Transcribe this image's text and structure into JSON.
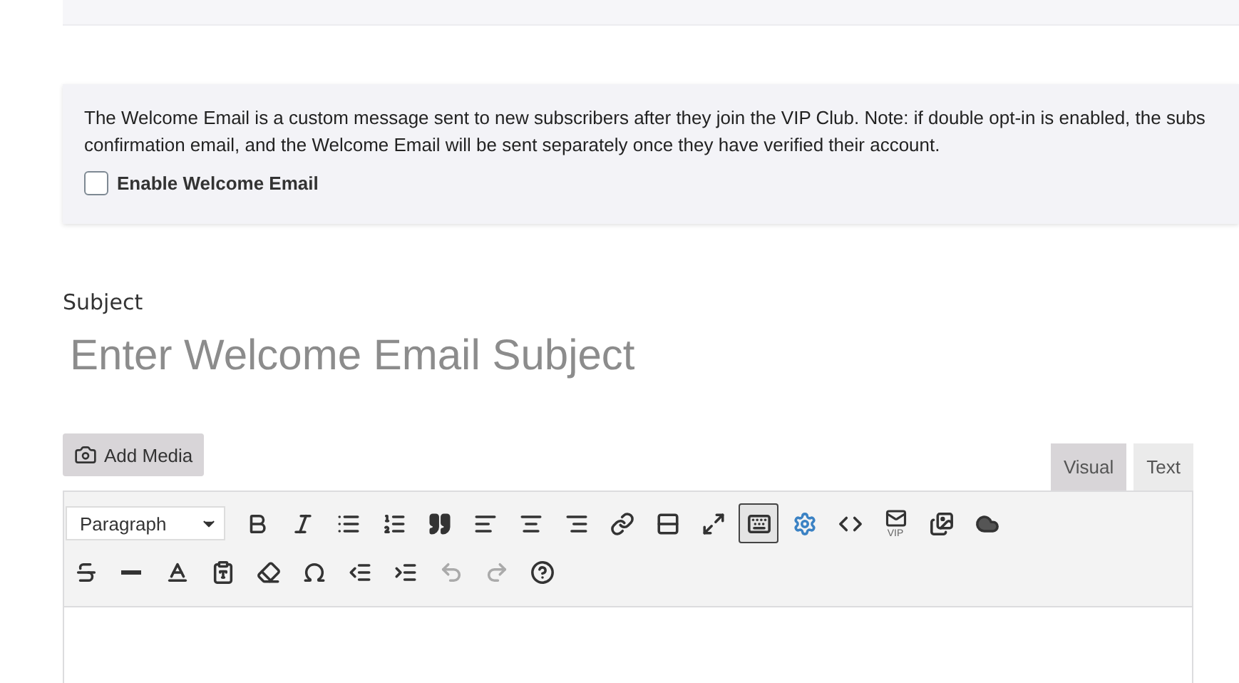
{
  "notice": {
    "lines": [
      "The Welcome Email is a custom message sent to new subscribers after they join the VIP Club. Note: if double opt-in is enabled, the subs",
      "confirmation email, and the Welcome Email will be sent separately once they have verified their account."
    ],
    "checkbox": {
      "label": "Enable Welcome Email",
      "checked": false
    }
  },
  "subject": {
    "label": "Subject",
    "placeholder": "Enter Welcome Email Subject"
  },
  "add_media": "Add Media",
  "tabs": [
    {
      "label": "Visual",
      "selected": true
    },
    {
      "label": "Text",
      "selected": false
    }
  ],
  "toolbar": {
    "format": "Paragraph",
    "keyboard_active": true,
    "vip_label": "VIP"
  }
}
